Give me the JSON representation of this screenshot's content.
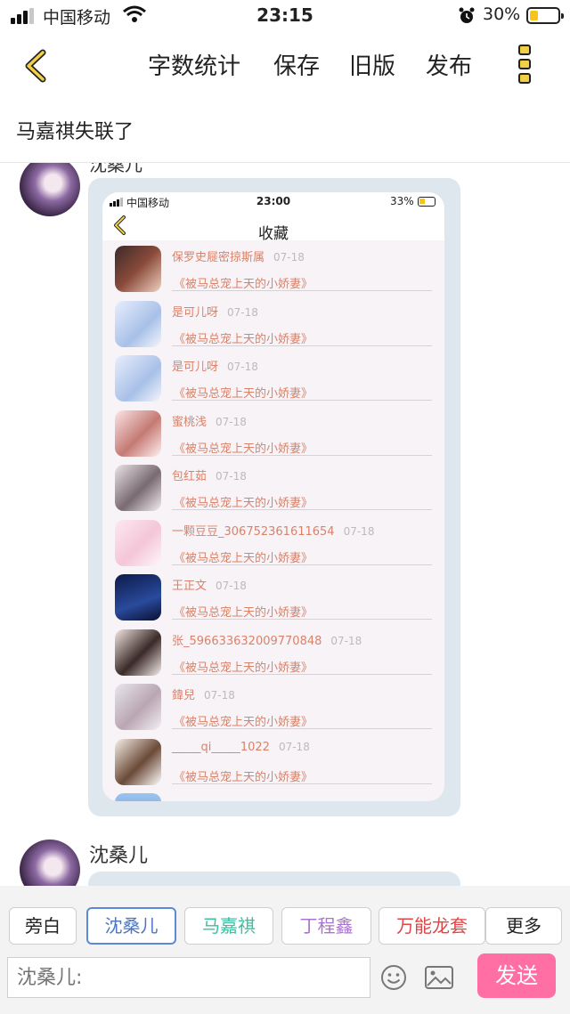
{
  "status_bar": {
    "carrier": "中国移动",
    "time": "23:15",
    "battery_percent": "30%",
    "battery_level": 0.3,
    "icons": [
      "signal-icon",
      "wifi-icon",
      "alarm-icon",
      "battery-icon"
    ]
  },
  "nav": {
    "back_icon": "chevron-left-icon",
    "items": [
      "字数统计",
      "保存",
      "旧版",
      "发布"
    ],
    "more_icon": "more-vertical-icon"
  },
  "document": {
    "title": "马嘉祺失联了"
  },
  "messages": [
    {
      "speaker": "",
      "screenshot": {
        "status": {
          "carrier": "中国移动",
          "time": "23:00",
          "battery_percent": "33%"
        },
        "title": "收藏",
        "rows": [
          {
            "user": "保罗史屣密掠斯属",
            "date": "07-18",
            "book": "《被马总宠上天的小娇妻》"
          },
          {
            "user": "是可儿呀",
            "date": "07-18",
            "book": "《被马总宠上天的小娇妻》"
          },
          {
            "user": "是可儿呀",
            "date": "07-18",
            "book": "《被马总宠上天的小娇妻》"
          },
          {
            "user": "蜜桃浅",
            "date": "07-18",
            "book": "《被马总宠上天的小娇妻》"
          },
          {
            "user": "包红茹",
            "date": "07-18",
            "book": "《被马总宠上天的小娇妻》"
          },
          {
            "user": "一颗豆豆_306752361611654",
            "date": "07-18",
            "book": "《被马总宠上天的小娇妻》"
          },
          {
            "user": "王正文",
            "date": "07-18",
            "book": "《被马总宠上天的小娇妻》"
          },
          {
            "user": "张_596633632009770848",
            "date": "07-18",
            "book": "《被马总宠上天的小娇妻》"
          },
          {
            "user": "鍏兒",
            "date": "07-18",
            "book": "《被马总宠上天的小娇妻》"
          },
          {
            "user": "_____qi_____1022",
            "date": "07-18",
            "book": "《被马总宠上天的小娇妻》"
          }
        ]
      }
    },
    {
      "speaker": "沈桑儿"
    }
  ],
  "roles": [
    {
      "label": "旁白",
      "color": "#222222",
      "active": false
    },
    {
      "label": "沈桑儿",
      "color": "#4a76c4",
      "active": true
    },
    {
      "label": "马嘉祺",
      "color": "#3fbf9f",
      "active": false
    },
    {
      "label": "丁程鑫",
      "color": "#a874d0",
      "active": false
    },
    {
      "label": "万能龙套",
      "color": "#e04646",
      "active": false
    },
    {
      "label": "更多",
      "color": "#222222",
      "active": false
    }
  ],
  "composer": {
    "placeholder": "沈桑儿:",
    "emoji_icon": "emoji-icon",
    "image_icon": "image-icon",
    "send_label": "发送",
    "send_color": "#ff6fa3"
  }
}
